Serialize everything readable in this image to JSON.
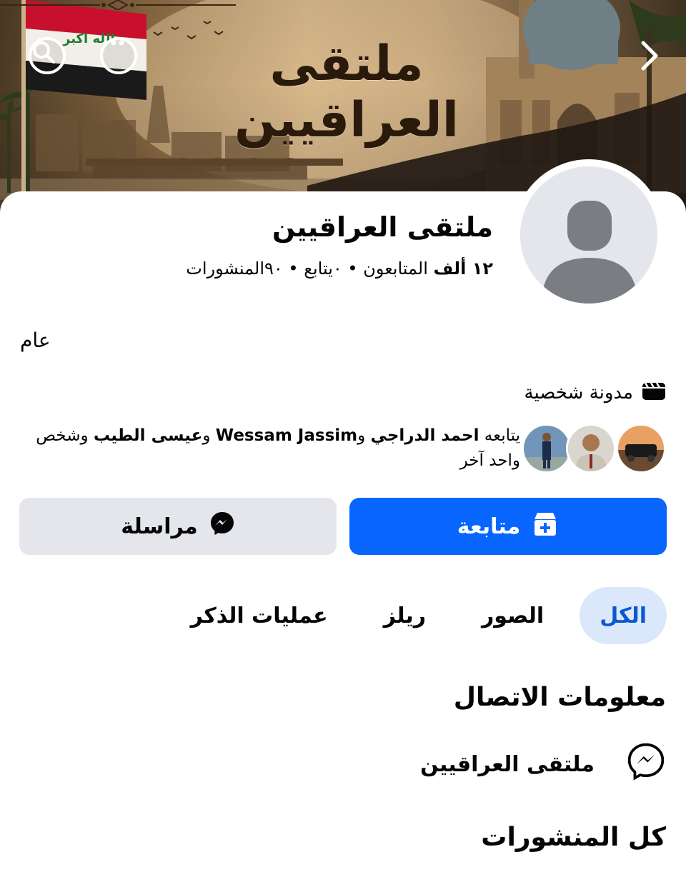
{
  "cover": {
    "title": "ملتقى العراقيين",
    "flag_text": "الله اكبر",
    "search_icon": "search-icon",
    "more_icon": "more-horizontal-icon",
    "back_icon": "chevron-right-icon"
  },
  "profile": {
    "name": "ملتقى العراقيين",
    "stats": {
      "followers_count": "١٢ ألف",
      "followers_label": " المتابعون • ",
      "following": "٠يتابع • ",
      "posts": "٩٠المنشورات"
    },
    "visibility": "عام",
    "category_icon": "video-clapper-icon",
    "category": "مدونة شخصية",
    "mutual": {
      "prefix": "يتابعه ",
      "name1": "احمد الدراجي",
      "and1": " و",
      "name2": "Wessam Jassim",
      "and2": " و",
      "name3": "عيسى الطيب",
      "suffix": " وشخص واحد آخر"
    }
  },
  "actions": {
    "follow_label": "متابعة",
    "follow_icon": "follow-page-icon",
    "message_label": "مراسلة",
    "message_icon": "messenger-icon"
  },
  "tabs": [
    {
      "label": "الكل",
      "active": true
    },
    {
      "label": "الصور",
      "active": false
    },
    {
      "label": "ريلز",
      "active": false
    },
    {
      "label": "عمليات الذكر",
      "active": false
    }
  ],
  "contact": {
    "title": "معلومات الاتصال",
    "messenger_name": "ملتقى العراقيين",
    "messenger_icon": "messenger-icon"
  },
  "posts_section": {
    "title": "كل المنشورات"
  },
  "colors": {
    "accent": "#0866ff",
    "active_tab_bg": "#dbe7fb",
    "active_tab_text": "#0a58d0",
    "secondary_button": "#e4e6eb"
  }
}
